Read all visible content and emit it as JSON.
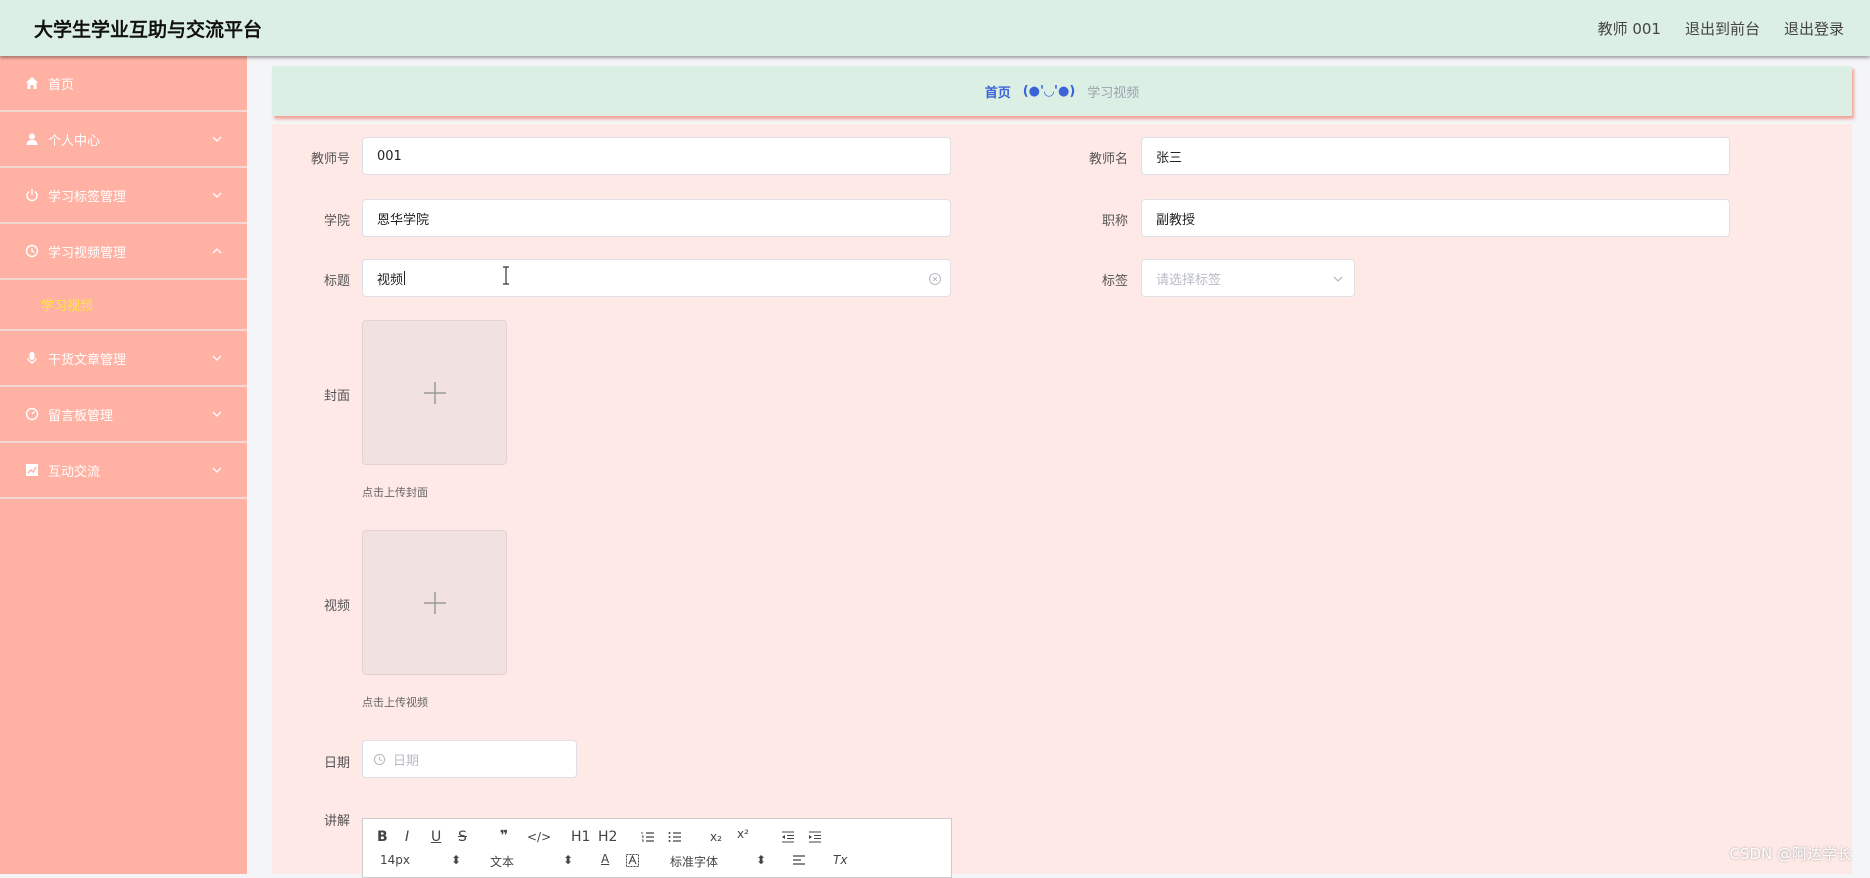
{
  "header": {
    "title": "大学生学业互助与交流平台",
    "user": "教师 001",
    "back_front": "退出到前台",
    "logout": "退出登录"
  },
  "sidebar": {
    "items": [
      {
        "label": "首页",
        "icon": "home-icon"
      },
      {
        "label": "个人中心",
        "icon": "user-icon"
      },
      {
        "label": "学习标签管理",
        "icon": "power-icon"
      },
      {
        "label": "学习视频管理",
        "icon": "clock-icon",
        "expanded": true
      },
      {
        "label": "干货文章管理",
        "icon": "microphone-icon"
      },
      {
        "label": "留言板管理",
        "icon": "gauge-icon"
      },
      {
        "label": "互动交流",
        "icon": "chart-icon"
      }
    ],
    "sub_active": "学习视频"
  },
  "breadcrumb": {
    "home": "首页",
    "face": "(●'◡'●)",
    "current": "学习视频"
  },
  "form": {
    "teacher_no_label": "教师号",
    "teacher_no_value": "001",
    "teacher_name_label": "教师名",
    "teacher_name_value": "张三",
    "college_label": "学院",
    "college_value": "恩华学院",
    "title_rank_label": "职称",
    "title_rank_value": "副教授",
    "title_label": "标题",
    "title_value": "视频",
    "tag_label": "标签",
    "tag_placeholder": "请选择标签",
    "cover_label": "封面",
    "cover_hint": "点击上传封面",
    "video_label": "视频",
    "video_hint": "点击上传视频",
    "date_label": "日期",
    "date_placeholder": "日期",
    "explain_label": "讲解"
  },
  "editor": {
    "bold": "B",
    "italic": "I",
    "underline": "U",
    "strike": "S",
    "quote": "❞",
    "code": "</>",
    "h1": "H1",
    "h2": "H2",
    "sub": "x₂",
    "sup": "x²",
    "size": "14px",
    "block": "文本",
    "font": "标准字体",
    "color": "A",
    "clear": "Tx"
  },
  "watermark": "CSDN @阿达学长",
  "colors": {
    "header_bg": "#dcefe4",
    "sidebar_bg": "#ffb2a3",
    "content_bg": "#ffe9e6",
    "active_sub": "#ffe83a",
    "breadcrumb_link": "#3a64d8"
  }
}
